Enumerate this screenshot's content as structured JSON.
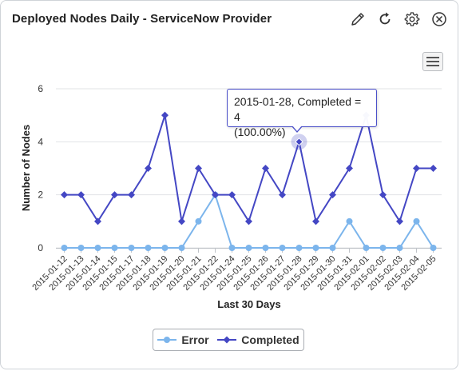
{
  "header": {
    "title": "Deployed Nodes Daily - ServiceNow Provider"
  },
  "toolbar": {
    "icons": [
      "edit-icon",
      "refresh-icon",
      "gear-icon",
      "close-icon"
    ]
  },
  "tooltip": {
    "line1": "2015-01-28, Completed = 4",
    "line2": "(100.00%)"
  },
  "chart_data": {
    "type": "line",
    "title": "Deployed Nodes Daily - ServiceNow Provider",
    "xlabel": "Last 30 Days",
    "ylabel": "Number of Nodes",
    "ylim": [
      0,
      6
    ],
    "yticks": [
      0,
      2,
      4,
      6
    ],
    "grid": true,
    "legend_position": "bottom",
    "categories": [
      "2015-01-12",
      "2015-01-13",
      "2015-01-14",
      "2015-01-15",
      "2015-01-17",
      "2015-01-18",
      "2015-01-19",
      "2015-01-20",
      "2015-01-21",
      "2015-01-22",
      "2015-01-24",
      "2015-01-25",
      "2015-01-26",
      "2015-01-27",
      "2015-01-28",
      "2015-01-29",
      "2015-01-30",
      "2015-01-31",
      "2015-02-01",
      "2015-02-02",
      "2015-02-03",
      "2015-02-04",
      "2015-02-05"
    ],
    "series": [
      {
        "name": "Error",
        "color": "#7cb5ec",
        "values": [
          0,
          0,
          0,
          0,
          0,
          0,
          0,
          0,
          1,
          2,
          0,
          0,
          0,
          0,
          0,
          0,
          0,
          1,
          0,
          0,
          0,
          1,
          0
        ]
      },
      {
        "name": "Completed",
        "color": "#4447c4",
        "values": [
          2,
          2,
          1,
          2,
          2,
          3,
          5,
          1,
          3,
          2,
          2,
          1,
          3,
          2,
          4,
          1,
          2,
          3,
          5,
          2,
          1,
          3,
          3
        ]
      }
    ]
  }
}
